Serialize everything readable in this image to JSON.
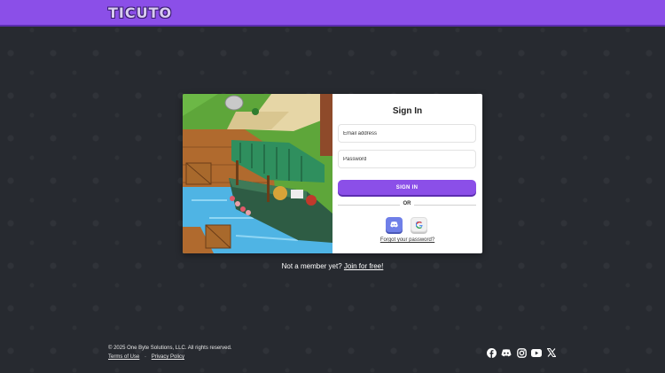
{
  "header": {
    "logo": "TICUTO"
  },
  "signin": {
    "title": "Sign In",
    "email_placeholder": "Email address",
    "password_placeholder": "Password",
    "submit_label": "SIGN IN",
    "divider": "OR",
    "forgot_link": "Forgot your password?",
    "providers": [
      {
        "name": "discord",
        "icon": "discord-icon"
      },
      {
        "name": "google",
        "icon": "google-icon"
      }
    ]
  },
  "signup": {
    "prompt": "Not a member yet?",
    "link": "Join for free!"
  },
  "footer": {
    "copyright": "© 2025 One Byte Solutions, LLC. All rights reserved.",
    "terms": "Terms of Use",
    "separator": "·",
    "privacy": "Privacy Policy",
    "social_icons": [
      "facebook-icon",
      "discord-icon",
      "instagram-icon",
      "youtube-icon",
      "x-icon"
    ]
  },
  "colors": {
    "accent": "#8b4fe8",
    "background": "#272a30",
    "discord": "#6f7fe8"
  }
}
